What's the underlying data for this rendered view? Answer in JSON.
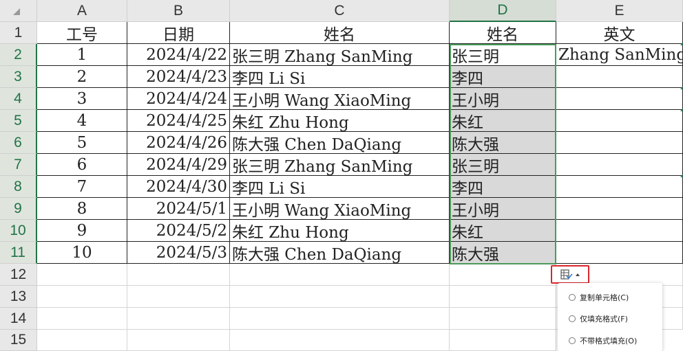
{
  "columns": [
    "A",
    "B",
    "C",
    "D",
    "E"
  ],
  "rows": [
    "1",
    "2",
    "3",
    "4",
    "5",
    "6",
    "7",
    "8",
    "9",
    "10",
    "11",
    "12",
    "13",
    "14",
    "15"
  ],
  "header": {
    "A": "工号",
    "B": "日期",
    "C": "姓名",
    "D": "姓名",
    "E": "英文"
  },
  "data": [
    {
      "id": "1",
      "date": "2024/4/22",
      "full": "张三明 Zhang SanMing",
      "name": "张三明",
      "en": "Zhang SanMing"
    },
    {
      "id": "2",
      "date": "2024/4/23",
      "full": "李四 Li Si",
      "name": "李四",
      "en": ""
    },
    {
      "id": "3",
      "date": "2024/4/24",
      "full": "王小明 Wang XiaoMing",
      "name": "王小明",
      "en": ""
    },
    {
      "id": "4",
      "date": "2024/4/25",
      "full": "朱红 Zhu Hong",
      "name": "朱红",
      "en": ""
    },
    {
      "id": "5",
      "date": "2024/4/26",
      "full": "陈大强 Chen DaQiang",
      "name": "陈大强",
      "en": ""
    },
    {
      "id": "6",
      "date": "2024/4/29",
      "full": "张三明 Zhang SanMing",
      "name": "张三明",
      "en": ""
    },
    {
      "id": "7",
      "date": "2024/4/30",
      "full": "李四 Li Si",
      "name": "李四",
      "en": ""
    },
    {
      "id": "8",
      "date": "2024/5/1",
      "full": "王小明 Wang XiaoMing",
      "name": "王小明",
      "en": ""
    },
    {
      "id": "9",
      "date": "2024/5/2",
      "full": "朱红 Zhu Hong",
      "name": "朱红",
      "en": ""
    },
    {
      "id": "10",
      "date": "2024/5/3",
      "full": "陈大强 Chen DaQiang",
      "name": "陈大强",
      "en": ""
    }
  ],
  "paste_options": {
    "icon": "paste-options-icon",
    "items": [
      "复制单元格(C)",
      "仅填充格式(F)",
      "不带格式填充(O)"
    ]
  },
  "colors": {
    "selection": "#4a9a5a",
    "header_selected": "#217346",
    "highlight_border": "#d9262c"
  }
}
